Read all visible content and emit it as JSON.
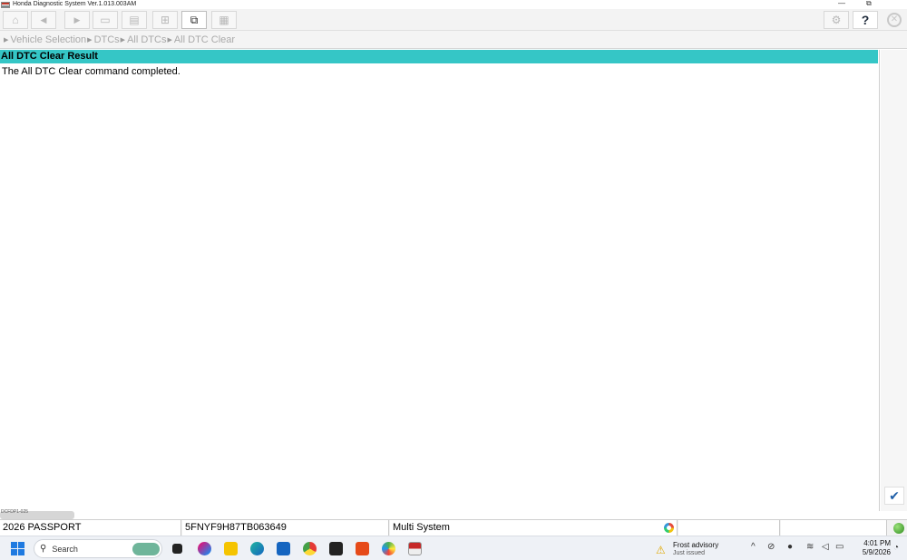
{
  "window": {
    "title": "Honda Diagnostic System Ver.1.013.003AM",
    "min_glyph": "—",
    "max_glyph": "⧉"
  },
  "toolbar": {
    "buttons": [
      {
        "icon": "home-icon",
        "glyph": "⌂"
      },
      {
        "icon": "back-arrow-icon",
        "glyph": "◀"
      },
      {
        "icon": "forward-arrow-icon",
        "glyph": "▶"
      },
      {
        "icon": "folder-icon",
        "glyph": "▭"
      },
      {
        "icon": "print-icon",
        "glyph": "▤"
      },
      {
        "icon": "save-screen-icon",
        "glyph": "⊞"
      },
      {
        "icon": "window-snapshot-icon",
        "glyph": "⧉"
      },
      {
        "icon": "report-icon",
        "glyph": "▦"
      }
    ],
    "settings_glyph": "⚙",
    "help_label": "?",
    "close_glyph": "✕"
  },
  "breadcrumb": [
    "Vehicle Selection",
    "DTCs",
    "All DTCs",
    "All DTC Clear"
  ],
  "breadcrumb_sep": "▶",
  "result": {
    "header": "All DTC Clear Result",
    "message": "The All DTC Clear command completed."
  },
  "confirm_glyph": "✔",
  "overlay_code": "DCFDP1-025",
  "status": {
    "vehicle": "2026 PASSPORT",
    "vin": "5FNYF9H87TB063649",
    "system": "Multi System"
  },
  "taskbar": {
    "search_placeholder": "Search",
    "weather_title": "Frost advisory",
    "weather_sub": "Just issued",
    "time": "4:01 PM",
    "date": "5/9/2026"
  },
  "colors": {
    "header_bg": "#35c6c6",
    "accent_blue": "#1f5fa8",
    "connected_green": "#2e8b1e"
  }
}
